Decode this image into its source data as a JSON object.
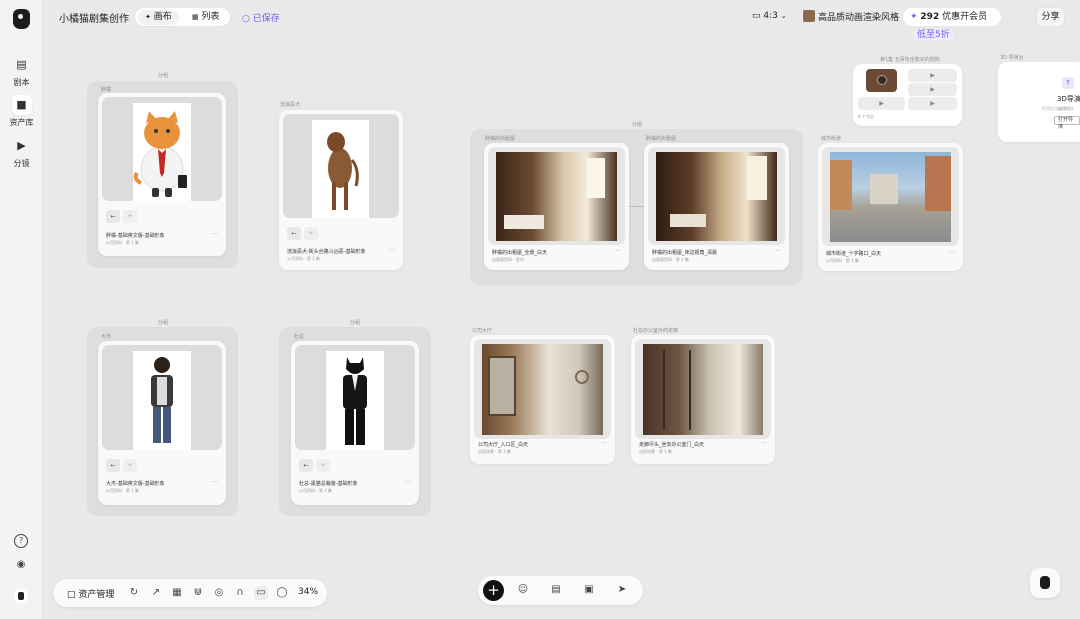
{
  "app": {
    "title": "小橘猫剧集创作"
  },
  "left_nav": {
    "items": [
      {
        "label": "剧本",
        "icon": "book-icon"
      },
      {
        "label": "资产库",
        "icon": "folder-icon"
      },
      {
        "label": "分镜",
        "icon": "play-icon"
      }
    ]
  },
  "toolbar": {
    "views": [
      {
        "label": "画布",
        "icon": "canvas-icon"
      },
      {
        "label": "列表",
        "icon": "grid-icon"
      }
    ],
    "saved": "已保存",
    "ratio": "4:3",
    "style": "高品质动画渲染风格",
    "credits": "292",
    "vip": "优惠开会员",
    "discount": "低至5折",
    "share": "分享"
  },
  "groups": {
    "fatcat": {
      "label": "分组",
      "tag": "胖橘",
      "name": "胖橘-基础英文版-基础形象",
      "meta": "公司资料 · 第 1 集"
    },
    "dog": {
      "tag": "流浪恶犬",
      "name": "流浪恶犬-街头丝路斗凶恶-基础形象",
      "meta": "公司资料 · 第 1 集"
    },
    "rooms": {
      "label": "分组",
      "tag1": "胖橘的出租屋",
      "tag2": "胖橘的出租屋",
      "name1": "胖橘的出租屋_全景_白天",
      "meta1": "出租屋资料 · 室内",
      "name2": "胖橘的出租屋_床边视角_清晨",
      "meta2": "出租屋资料 · 第 1 集"
    },
    "city": {
      "tag": "城市街道",
      "name": "城市街道_十字路口_白天",
      "meta": "公司资料 · 第 1 集"
    },
    "storyboard": {
      "label": "第1集 五百块全款买的狗狗",
      "caption": "8 个节点"
    },
    "director": {
      "label": "3D 导演台",
      "title": "3D导演",
      "desc": "打开后可编辑镜头",
      "button": "打开导演"
    },
    "dajie": {
      "label": "分组",
      "tag": "大杰",
      "name": "大杰-基础英文版-基础形象",
      "meta": "公司资料 · 第 1 集"
    },
    "dujiao": {
      "label": "分组",
      "tag": "杜总",
      "name": "杜总-黑猫总裁装-基础形象",
      "meta": "公司资料 · 第 1 集"
    },
    "lobby": {
      "tag": "公司大厅",
      "name": "公司大厅_入口区_白天",
      "meta": "出现场景 · 第 1 集"
    },
    "corridor": {
      "tag": "杜总办公室外的走廊",
      "name": "走廊尽头_坐向办公室门_白天",
      "meta": "出现场景 · 第 1 集"
    }
  },
  "bottom": {
    "asset_mgmt": "资产管理",
    "zoom": "34%"
  },
  "colors": {
    "accent": "#7b5cf0",
    "bg": "#e9e9e9"
  }
}
